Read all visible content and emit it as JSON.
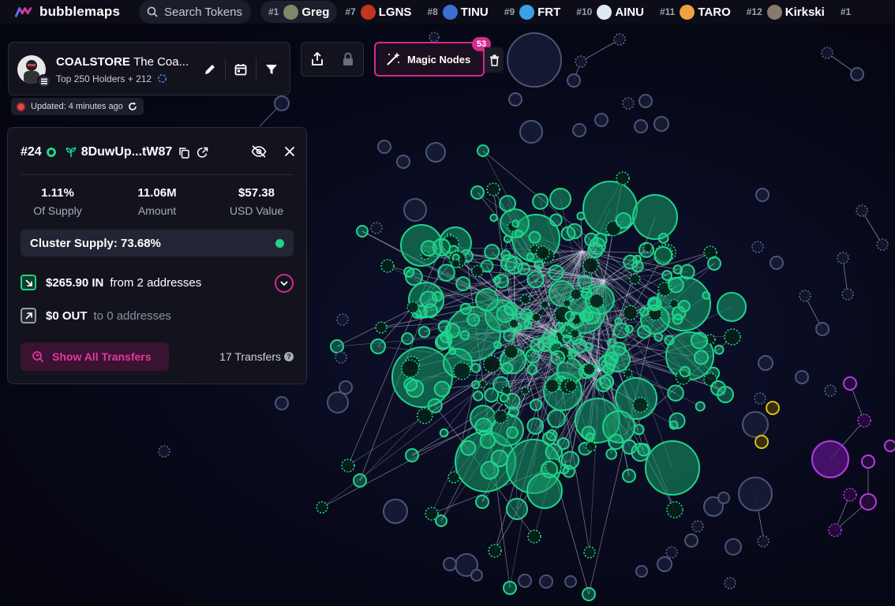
{
  "app": {
    "name": "bubblemaps"
  },
  "search": {
    "placeholder": "Search Tokens"
  },
  "tabs": [
    {
      "rank": "#1",
      "name": "Greg",
      "color": "#7a8a6a",
      "active": true
    },
    {
      "rank": "#7",
      "name": "LGNS",
      "color": "#c0361f"
    },
    {
      "rank": "#8",
      "name": "TINU",
      "color": "#3a6fd1"
    },
    {
      "rank": "#9",
      "name": "FRT",
      "color": "#3aa0e8"
    },
    {
      "rank": "#10",
      "name": "AINU",
      "color": "#dfe9f5"
    },
    {
      "rank": "#11",
      "name": "TARO",
      "color": "#f0a040"
    },
    {
      "rank": "#12",
      "name": "Kirkski",
      "color": "#8a7a6e"
    },
    {
      "rank": "#1",
      "name": "",
      "color": "#555"
    }
  ],
  "token": {
    "symbol": "COALSTORE",
    "name": "The Coa...",
    "holders": "Top 250 Holders + 212",
    "updated": "Updated: 4 minutes ago"
  },
  "magic": {
    "label": "Magic Nodes",
    "count": "53"
  },
  "wallet": {
    "rank": "#24",
    "address": "8DuwUp...tW87",
    "supply": {
      "value": "1.11%",
      "label": "Of Supply"
    },
    "amount": {
      "value": "11.06M",
      "label": "Amount"
    },
    "usd": {
      "value": "$57.38",
      "label": "USD Value"
    },
    "cluster_supply": "Cluster Supply: 73.68%",
    "in": {
      "amount": "$265.90 IN",
      "desc": "from 2 addresses"
    },
    "out": {
      "amount": "$0 OUT",
      "desc": "to 0 addresses"
    },
    "show_transfers": "Show All Transfers",
    "transfers_count": "17 Transfers"
  },
  "colors": {
    "cluster_green": "#1fd48c",
    "purple": "#b03ee0",
    "yellow": "#d8c020",
    "node_blue": "#4a5478",
    "accent_pink": "#d42a8f"
  }
}
